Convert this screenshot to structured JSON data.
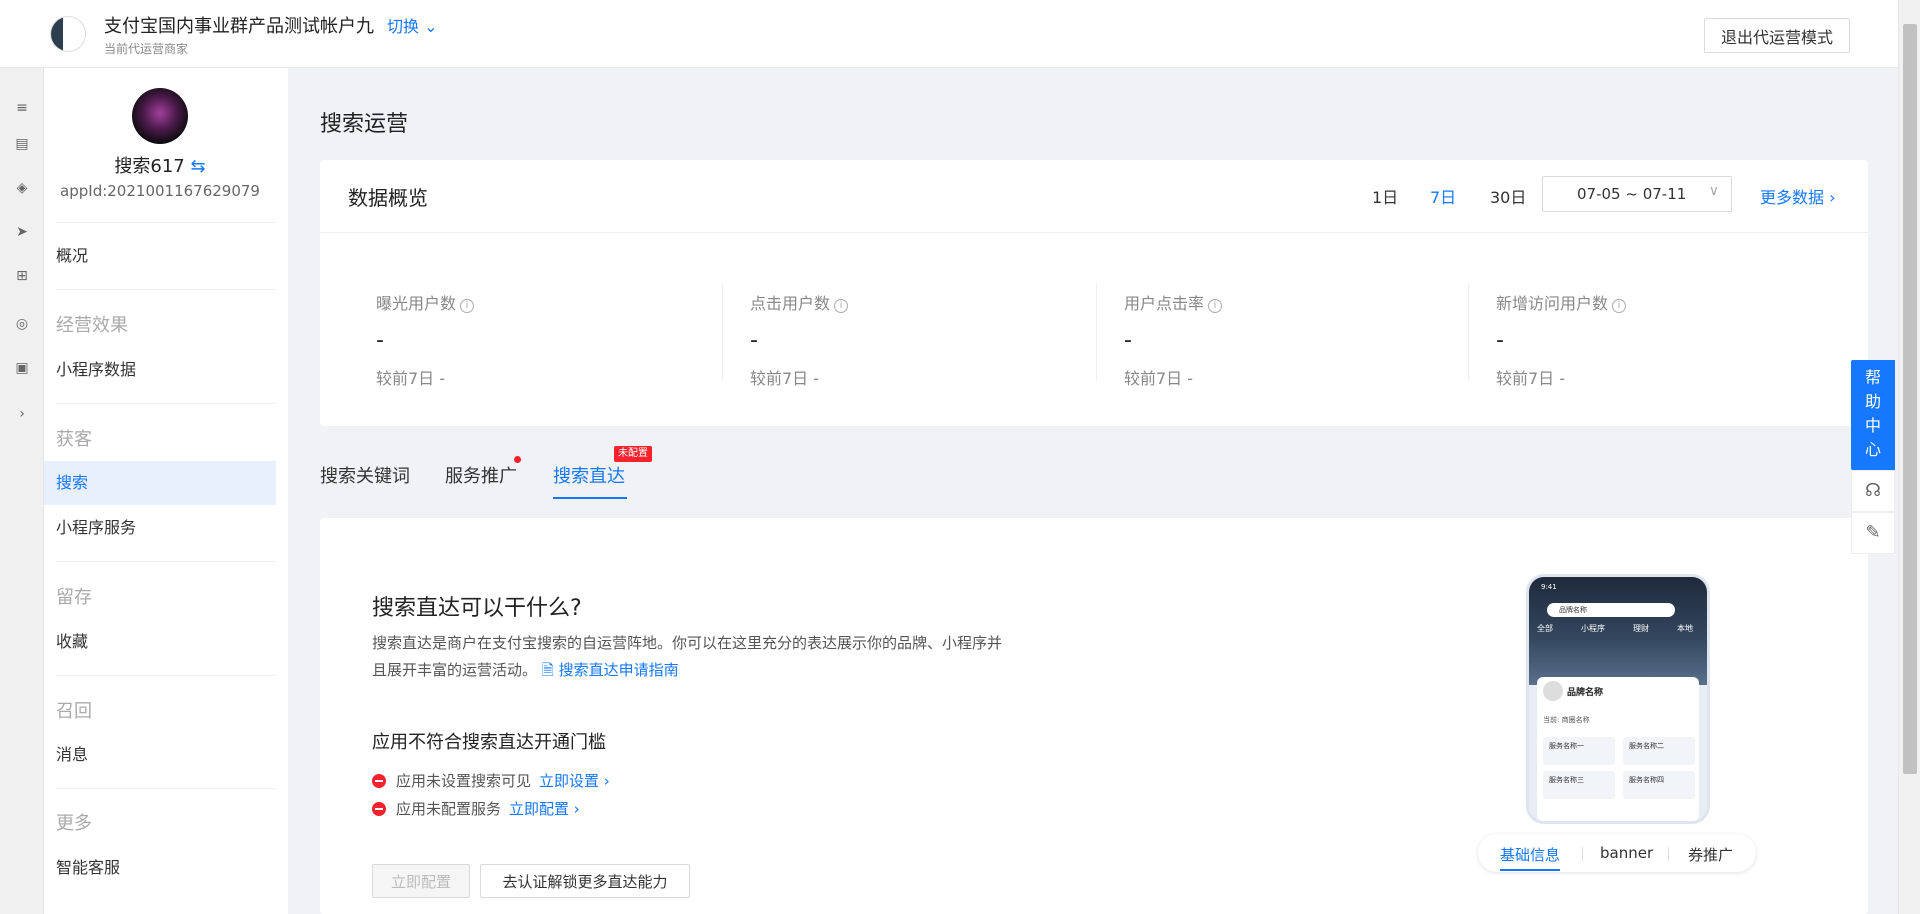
{
  "header": {
    "account_name": "支付宝国内事业群产品测试帐户九",
    "switch_label": "切换",
    "account_sub": "当前代运营商家",
    "exit_button": "退出代运营模式"
  },
  "app": {
    "name": "搜索617",
    "id": "appId:2021001167629079"
  },
  "nav": {
    "overview": "概况",
    "group_effect": "经营效果",
    "miniapp_data": "小程序数据",
    "group_acquire": "获客",
    "search": "搜索",
    "miniapp_service": "小程序服务",
    "group_retain": "留存",
    "favorites": "收藏",
    "group_recall": "召回",
    "messages": "消息",
    "group_more": "更多",
    "smart_service": "智能客服"
  },
  "page": {
    "title": "搜索运营"
  },
  "overview": {
    "title": "数据概览",
    "ranges": [
      "1日",
      "7日",
      "30日"
    ],
    "active_range": "7日",
    "date_range": "07-05 ~ 07-11",
    "more_data": "更多数据",
    "metrics": [
      {
        "label": "曝光用户数",
        "value": "-",
        "compare": "较前7日 -"
      },
      {
        "label": "点击用户数",
        "value": "-",
        "compare": "较前7日 -"
      },
      {
        "label": "用户点击率",
        "value": "-",
        "compare": "较前7日 -"
      },
      {
        "label": "新增访问用户数",
        "value": "-",
        "compare": "较前7日 -"
      }
    ]
  },
  "tabs": {
    "keywords": "搜索关键词",
    "promotion": "服务推广",
    "direct": "搜索直达",
    "direct_badge": "未配置"
  },
  "direct": {
    "question": "搜索直达可以干什么?",
    "desc": "搜索直达是商户在支付宝搜索的自运营阵地。你可以在这里充分的表达展示你的品牌、小程序并且展开丰富的运营活动。",
    "guide_link": "搜索直达申请指南",
    "threshold_title": "应用不符合搜索直达开通门槛",
    "requirements": [
      {
        "text": "应用未设置搜索可见",
        "action": "立即设置"
      },
      {
        "text": "应用未配置服务",
        "action": "立即配置"
      }
    ],
    "btn_config": "立即配置",
    "btn_certify": "去认证解锁更多直达能力"
  },
  "preview": {
    "time": "9:41",
    "search_text": "品牌名称",
    "tabs": [
      "全部",
      "小程序",
      "理财",
      "本地"
    ],
    "brand": "品牌名称",
    "store": "当前: 商圈名称",
    "services": [
      "服务名称一",
      "服务名称二",
      "服务名称三",
      "服务名称四"
    ],
    "subtabs": [
      "基础信息",
      "banner",
      "券推广"
    ]
  },
  "help": {
    "label": "帮助中心"
  }
}
